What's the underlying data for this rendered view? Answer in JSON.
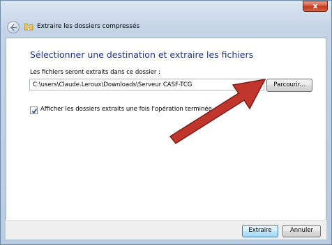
{
  "window": {
    "close_label": "x"
  },
  "header": {
    "title": "Extraire les dossiers compressés",
    "back_icon": "back-arrow-icon",
    "folder_icon": "zip-folder-icon"
  },
  "main": {
    "heading": "Sélectionner une destination et extraire les fichiers",
    "path_label": "Les fichiers seront extraits dans ce dossier :",
    "path_value": "C:\\users\\Claude.Leroux\\Downloads\\Serveur CASF-TCG",
    "browse_label": "Parcourir...",
    "show_folders_label": "Afficher les dossiers extraits une fois l'opération terminée",
    "show_folders_checked": true
  },
  "footer": {
    "extract_label": "Extraire",
    "cancel_label": "Annuler"
  },
  "annotation": {
    "arrow_color": "#c0362c"
  }
}
